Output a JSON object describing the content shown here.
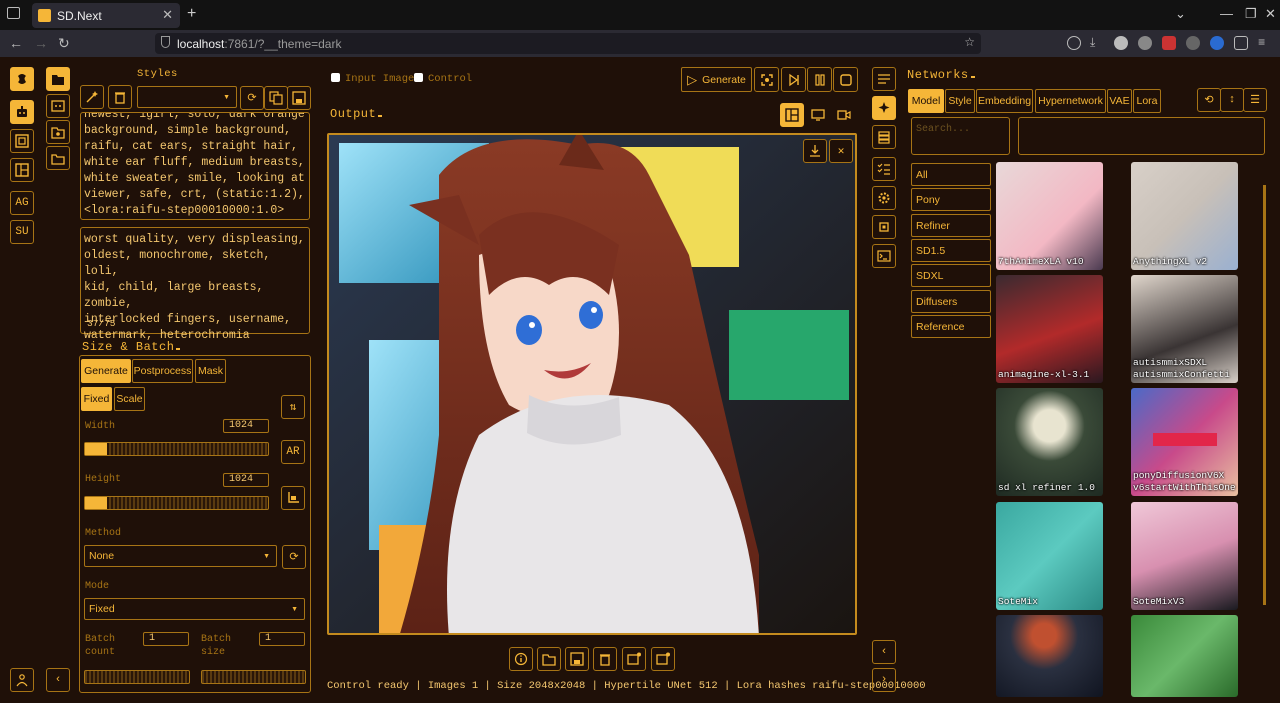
{
  "browser": {
    "tab_title": "SD.Next",
    "url_host": "localhost",
    "url_rest": ":7861/?__theme=dark"
  },
  "left_panel": {
    "styles_label": "Styles",
    "sidebar_text_buttons": [
      "AG",
      "SU"
    ],
    "prompt": "newest, 1girl, solo, dark orange\nbackground, simple background,\nraifu, cat ears, straight hair,\nwhite ear fluff, medium breasts,\nwhite sweater, smile, looking at\nviewer, safe, crt, (static:1.2),\n<lora:raifu-step00010000:1.0>",
    "negative_prompt": "worst quality, very displeasing,\noldest, monochrome, sketch, loli,\nkid, child, large breasts, zombie,\ninterlocked fingers, username,\nwatermark, heterochromia",
    "token_count": "37/75",
    "size_title": "Size & Batch",
    "size_tabs": [
      "Generate",
      "Postprocess",
      "Mask"
    ],
    "scale_tabs": [
      "Fixed",
      "Scale"
    ],
    "width_label": "Width",
    "width_value": "1024",
    "width_fraction": 0.12,
    "height_label": "Height",
    "height_value": "1024",
    "height_fraction": 0.12,
    "ar_label": "AR",
    "method_label": "Method",
    "method_value": "None",
    "mode_label": "Mode",
    "mode_value": "Fixed",
    "batch_count_label": "Batch\ncount",
    "batch_count_value": "1",
    "batch_size_label": "Batch\nsize",
    "batch_size_value": "1"
  },
  "center": {
    "input_image_label": "Input Image",
    "control_label": "Control",
    "output_title": "Output",
    "generate_label": "Generate",
    "status": "Control ready | Images 1 | Size 2048x2048 | Hypertile UNet 512 | Lora hashes raifu-step00010000"
  },
  "networks": {
    "title": "Networks",
    "tabs": [
      "Model",
      "Style",
      "Embedding",
      "Hypernetwork",
      "VAE",
      "Lora"
    ],
    "search_placeholder": "Search...",
    "categories": [
      "All",
      "Pony",
      "Refiner",
      "SD1.5",
      "SDXL",
      "Diffusers",
      "Reference"
    ],
    "cards": [
      {
        "name": "7thAnimeXLA v10"
      },
      {
        "name": "AnythingXL v2"
      },
      {
        "name": "animagine-xl-3.1"
      },
      {
        "name": "autismmixSDXL\nautismmixConfetti"
      },
      {
        "name": "sd xl refiner 1.0"
      },
      {
        "name": "ponyDiffusionV6X\nv6startWithThisOne"
      },
      {
        "name": "SoteMix"
      },
      {
        "name": "SoteMixV3"
      },
      {
        "name": ""
      },
      {
        "name": ""
      }
    ]
  },
  "colors": {
    "accent": "#f5b638",
    "background": "#1f1008",
    "border": "#a77415"
  }
}
